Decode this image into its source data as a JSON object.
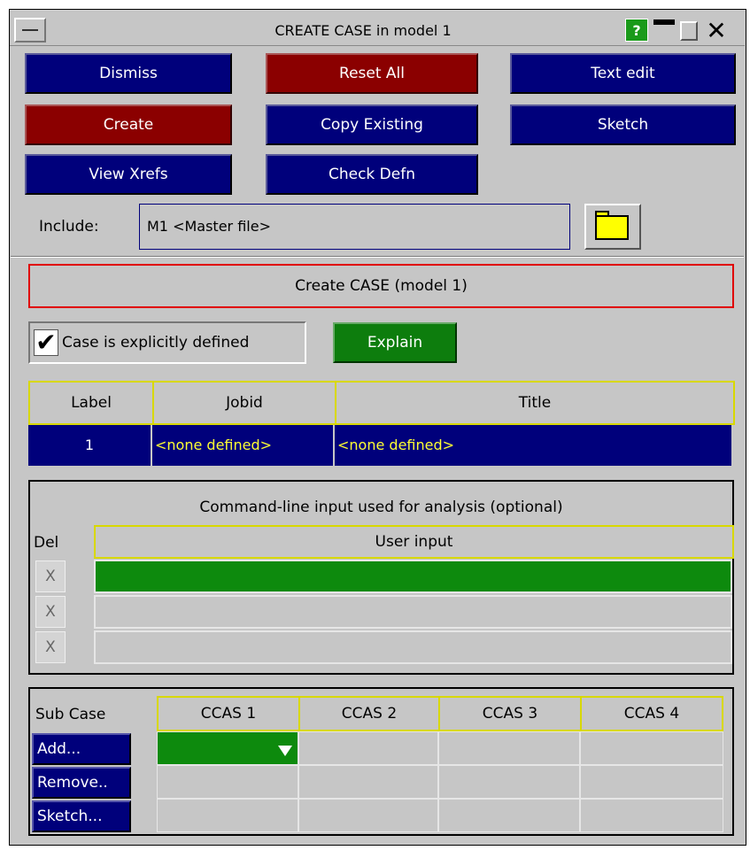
{
  "window": {
    "title": "CREATE CASE in model 1",
    "help_label": "?"
  },
  "toolbar": {
    "dismiss": "Dismiss",
    "reset_all": "Reset All",
    "text_edit": "Text edit",
    "create": "Create",
    "copy_existing": "Copy Existing",
    "sketch": "Sketch",
    "view_xrefs": "View Xrefs",
    "check_defn": "Check Defn"
  },
  "include": {
    "label": "Include:",
    "value": "M1  <Master file>"
  },
  "create_case_title": "Create CASE (model 1)",
  "explicit": {
    "label": "Case is explicitly defined",
    "checked": true,
    "explain_label": "Explain"
  },
  "case_table": {
    "headers": [
      "Label",
      "Jobid",
      "Title"
    ],
    "row": {
      "label": "1",
      "jobid": "<none defined>",
      "title": "<none defined>"
    }
  },
  "command_line": {
    "title": "Command-line input used for analysis (optional)",
    "del_header": "Del",
    "input_header": "User input",
    "del_symbol": "X"
  },
  "sub_case": {
    "label": "Sub Case",
    "columns": [
      "CCAS 1",
      "CCAS 2",
      "CCAS 3",
      "CCAS 4"
    ],
    "buttons": {
      "add": "Add...",
      "remove": "Remove..",
      "sketch": "Sketch..."
    }
  },
  "colors": {
    "panel": "#c6c6c6",
    "blue_button": "#00007b",
    "red_button": "#8b0000",
    "green": "#0d7d0d",
    "header_border": "#d8d800"
  }
}
